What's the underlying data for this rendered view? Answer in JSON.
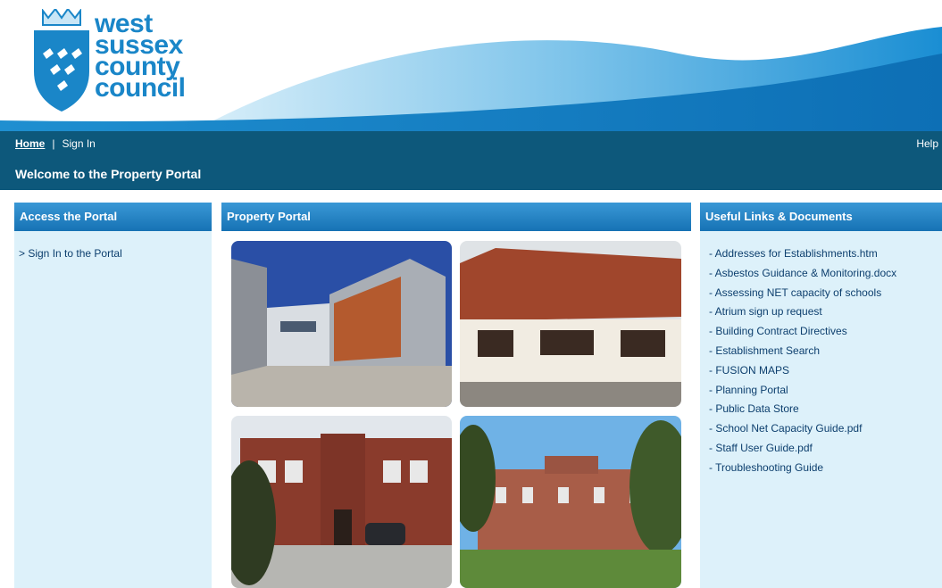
{
  "logo": {
    "line1": "west",
    "line2": "sussex",
    "line3": "county",
    "line4": "council"
  },
  "nav": {
    "home": "Home",
    "separator": "|",
    "sign_in": "Sign In",
    "help": "Help"
  },
  "welcome": "Welcome to the Property Portal",
  "left_panel": {
    "title": "Access the Portal",
    "link": "> Sign In to the Portal"
  },
  "middle_panel": {
    "title": "Property Portal"
  },
  "right_panel": {
    "title": "Useful Links & Documents",
    "links": [
      "- Addresses for Establishments.htm",
      "- Asbestos Guidance & Monitoring.docx",
      "- Assessing NET capacity of schools",
      "- Atrium sign up request",
      "- Building Contract Directives",
      "- Establishment Search",
      "- FUSION MAPS",
      "- Planning Portal",
      "- Public Data Store",
      "- School Net Capacity Guide.pdf",
      "- Staff User Guide.pdf",
      "- Troubleshooting Guide"
    ]
  },
  "colors": {
    "navbar": "#0d587b",
    "panel_header": "#1f7fc2",
    "panel_body": "#ddf1fa",
    "link": "#0d3f6e"
  }
}
